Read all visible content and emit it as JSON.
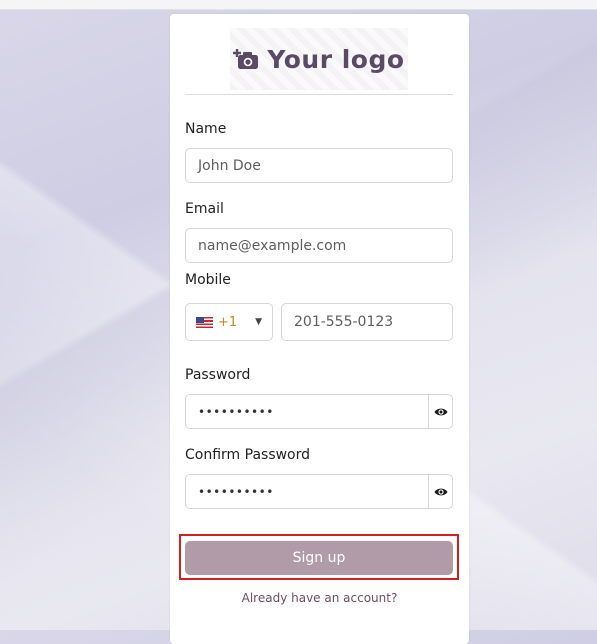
{
  "logo": {
    "text": "Your logo",
    "icon": "camera-plus-icon"
  },
  "form": {
    "name": {
      "label": "Name",
      "placeholder": "John Doe"
    },
    "email": {
      "label": "Email",
      "placeholder": "name@example.com"
    },
    "mobile": {
      "label": "Mobile",
      "country_code": "+1",
      "country_flag": "us-flag-icon",
      "placeholder": "201-555-0123"
    },
    "password": {
      "label": "Password",
      "value": "••••••••••",
      "toggle_icon": "eye-icon"
    },
    "confirm_password": {
      "label": "Confirm Password",
      "value": "••••••••••",
      "toggle_icon": "eye-icon"
    },
    "submit_label": "Sign up",
    "login_link": "Already have an account?"
  },
  "colors": {
    "brand": "#5b4a66",
    "button": "#b19ba8",
    "link": "#6e4e60",
    "highlight": "#d21f1f"
  }
}
